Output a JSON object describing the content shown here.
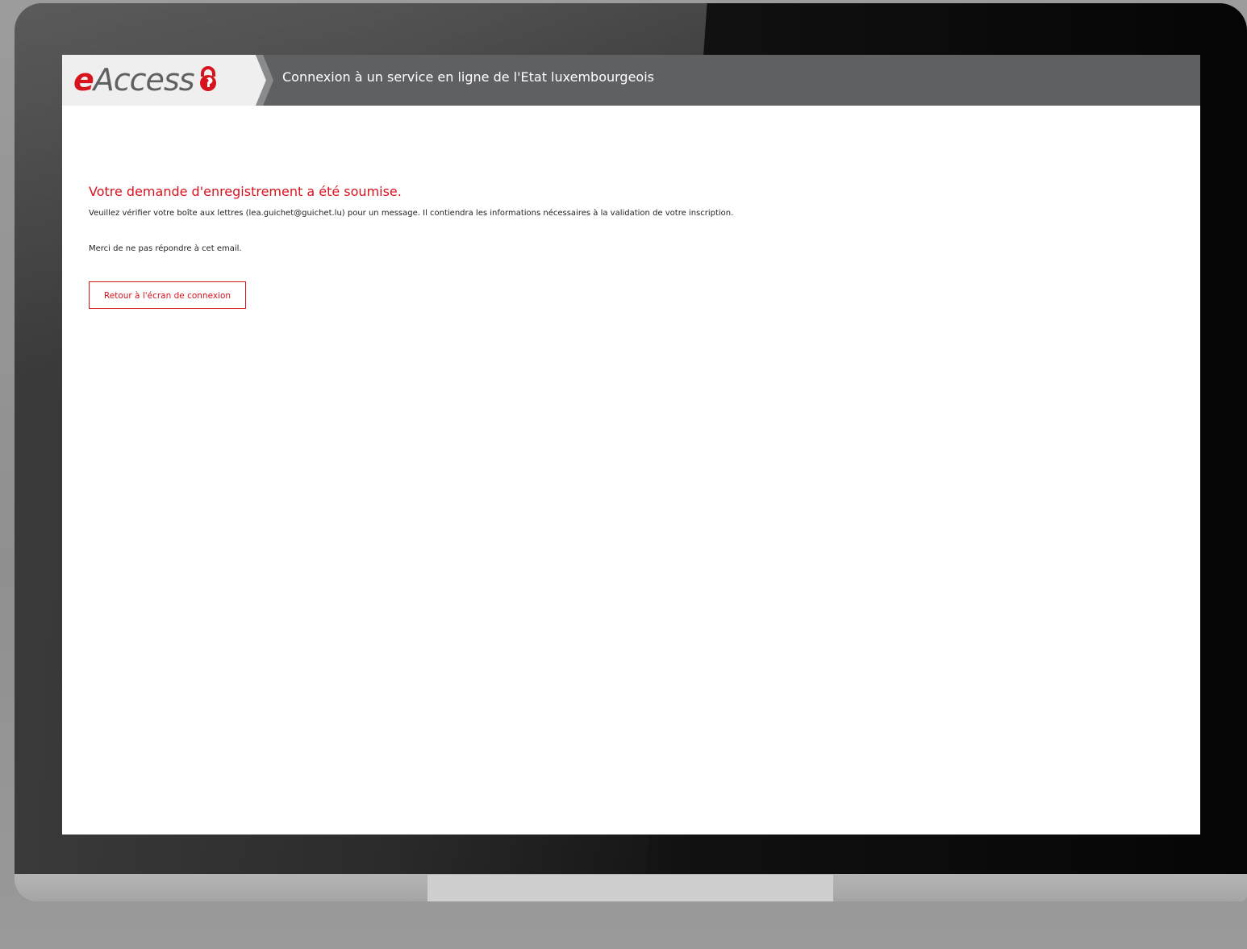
{
  "header": {
    "logo_prefix": "e",
    "logo_text": "Access",
    "title": "Connexion à un service en ligne de l'Etat luxembourgeois"
  },
  "main": {
    "headline": "Votre demande d'enregistrement a été soumise.",
    "message": "Veuillez vérifier votre boîte aux lettres (lea.guichet@guichet.lu) pour un message. Il contiendra les informations nécessaires à la validation de votre inscription.",
    "note": "Merci de ne pas répondre à cet email.",
    "back_button_label": "Retour à l'écran de connexion"
  },
  "colors": {
    "brand_red": "#d7131e",
    "header_gray": "#5f6062"
  },
  "icons": {
    "logo_lock": "padlock-icon"
  }
}
